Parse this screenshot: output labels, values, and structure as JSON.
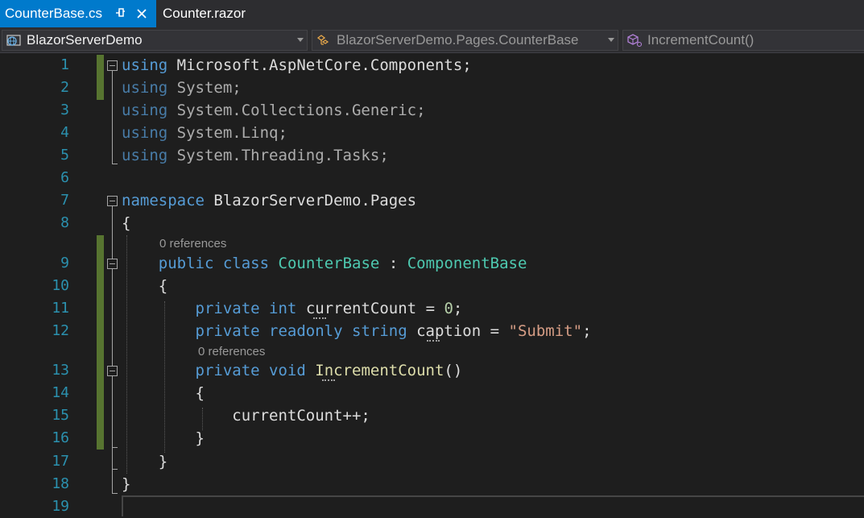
{
  "tabs": [
    {
      "label": "CounterBase.cs",
      "active": true
    },
    {
      "label": "Counter.razor",
      "active": false
    }
  ],
  "navbar": {
    "project": "BlazorServerDemo",
    "type_member": "BlazorServerDemo.Pages.CounterBase",
    "member": "IncrementCount()"
  },
  "editor": {
    "line_numbers": [
      "1",
      "2",
      "3",
      "4",
      "5",
      "6",
      "7",
      "8",
      "9",
      "10",
      "11",
      "12",
      "13",
      "14",
      "15",
      "16",
      "17",
      "18",
      "19"
    ],
    "code_lens": {
      "class_refs": "0 references",
      "method_refs": "0 references"
    },
    "lines": {
      "l1": {
        "kw": "using",
        "rest": "Microsoft.AspNetCore.Components;"
      },
      "l2": {
        "kw": "using",
        "rest": "System;"
      },
      "l3": {
        "kw": "using",
        "rest": "System.Collections.Generic;"
      },
      "l4": {
        "kw": "using",
        "rest": "System.Linq;"
      },
      "l5": {
        "kw": "using",
        "rest": "System.Threading.Tasks;"
      },
      "l7": {
        "kw": "namespace",
        "rest": "BlazorServerDemo.Pages"
      },
      "l8": {
        "text": "{"
      },
      "l9": {
        "kw1": "public",
        "kw2": "class",
        "name": "CounterBase",
        "sep": ":",
        "base": "ComponentBase"
      },
      "l10": {
        "text": "{"
      },
      "l11": {
        "kw1": "private",
        "kw2": "int",
        "name": "currentCount",
        "eq": "=",
        "val": "0",
        "end": ";"
      },
      "l12": {
        "kw1": "private",
        "kw2": "readonly",
        "kw3": "string",
        "name": "caption",
        "eq": "=",
        "val": "\"Submit\"",
        "end": ";"
      },
      "l13": {
        "kw1": "private",
        "kw2": "void",
        "name": "IncrementCount",
        "paren": "()"
      },
      "l14": {
        "text": "{"
      },
      "l15": {
        "text": "currentCount++;"
      },
      "l16": {
        "text": "}"
      },
      "l17": {
        "text": "}"
      },
      "l18": {
        "text": "}"
      }
    }
  },
  "colors": {
    "accent": "#007acc",
    "keyword": "#569cd6",
    "type": "#4ec9b0",
    "string": "#d69d85",
    "number": "#b5cea8",
    "method": "#dcdcaa",
    "line_number": "#2b91af",
    "change_bar": "#577430",
    "background": "#1e1e1e"
  },
  "icons": [
    "pin-icon",
    "close-icon",
    "csharp-project-icon",
    "class-icon",
    "method-icon"
  ]
}
